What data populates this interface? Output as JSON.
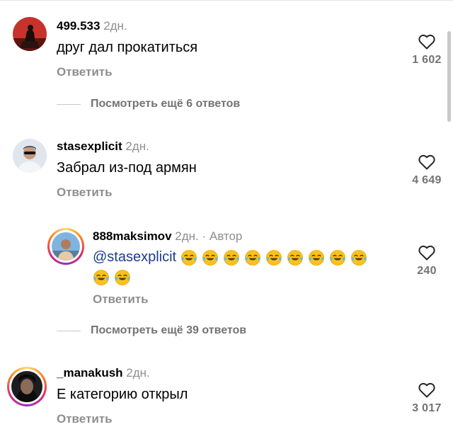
{
  "comments": [
    {
      "username": "499.533",
      "time": "2дн.",
      "text": "друг дал прокатиться",
      "reply_label": "Ответить",
      "likes": "1 602",
      "avatar": "red-bg-figure-avatar",
      "more_replies": "Посмотреть ещё 6 ответов"
    },
    {
      "username": "stasexplicit",
      "time": "2дн.",
      "text": "Забрал из-под армян",
      "reply_label": "Ответить",
      "likes": "4 649",
      "avatar": "man-with-sunglasses-avatar",
      "reply": {
        "username": "888maksimov",
        "time": "2дн.",
        "author_tag": "· Автор",
        "mention": "@stasexplicit",
        "emoji": "face-with-tears-of-joy",
        "emoji_count": 11,
        "reply_label": "Ответить",
        "likes": "240"
      },
      "more_replies": "Посмотреть ещё 39 ответов"
    },
    {
      "username": "_manakush",
      "time": "2дн.",
      "text": "Е категорию открыл",
      "reply_label": "Ответить",
      "likes": "3 017",
      "avatar": "hooded-man-avatar"
    }
  ],
  "icons": {
    "like": "heart-outline-icon"
  },
  "colors": {
    "mention": "#1b3c8c",
    "muted": "#8e8e8e",
    "story_ring": "#d6249f"
  }
}
